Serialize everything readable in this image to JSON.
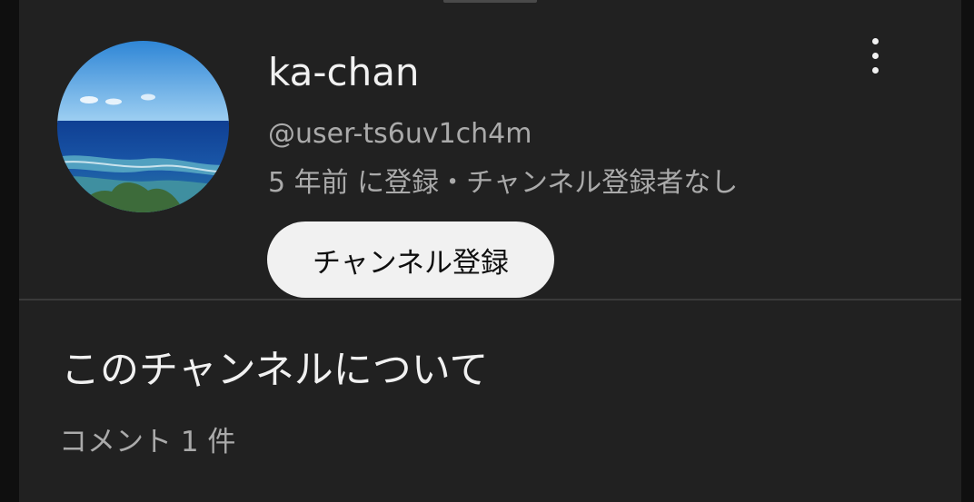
{
  "channel": {
    "name": "ka-chan",
    "handle": "@user-ts6uv1ch4m",
    "meta": "5 年前 に登録・チャンネル登録者なし",
    "subscribe_label": "チャンネル登録",
    "more_icon": "more-vert-icon"
  },
  "about": {
    "title": "このチャンネルについて",
    "comment_count": "コメント 1 件"
  },
  "colors": {
    "background": "#212121",
    "text_primary": "#f1f1f1",
    "text_secondary": "#aaaaaa",
    "button_bg": "#f1f1f1"
  }
}
